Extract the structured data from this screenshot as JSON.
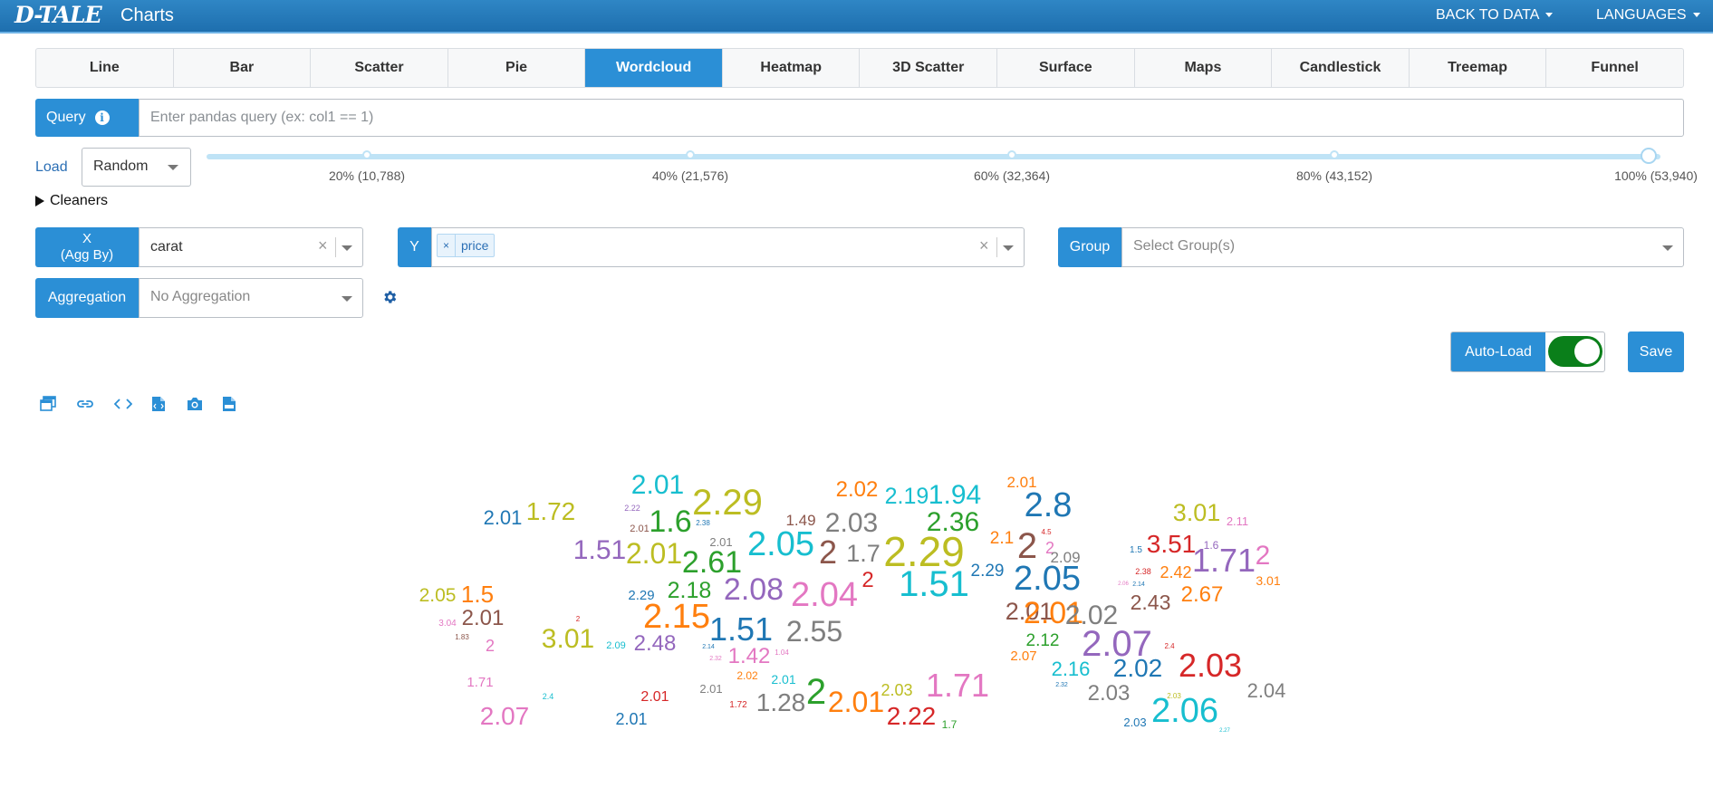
{
  "app": {
    "logo": "D-TALE",
    "title": "Charts"
  },
  "nav": {
    "back_to_data": "BACK TO DATA",
    "languages": "LANGUAGES"
  },
  "tabs": [
    {
      "label": "Line",
      "active": false
    },
    {
      "label": "Bar",
      "active": false
    },
    {
      "label": "Scatter",
      "active": false
    },
    {
      "label": "Pie",
      "active": false
    },
    {
      "label": "Wordcloud",
      "active": true
    },
    {
      "label": "Heatmap",
      "active": false
    },
    {
      "label": "3D Scatter",
      "active": false
    },
    {
      "label": "Surface",
      "active": false
    },
    {
      "label": "Maps",
      "active": false
    },
    {
      "label": "Candlestick",
      "active": false
    },
    {
      "label": "Treemap",
      "active": false
    },
    {
      "label": "Funnel",
      "active": false
    }
  ],
  "query": {
    "label": "Query",
    "value": "",
    "placeholder": "Enter pandas query (ex: col1 == 1)"
  },
  "load": {
    "label": "Load",
    "selected": "Random",
    "marks": [
      "20% (10,788)",
      "40% (21,576)",
      "60% (32,364)",
      "80% (43,152)",
      "100% (53,940)"
    ],
    "value_pct": 100
  },
  "cleaners": {
    "label": "Cleaners"
  },
  "x_axis": {
    "label_line1": "X",
    "label_line2": "(Agg By)",
    "value": "carat"
  },
  "y_axis": {
    "label": "Y",
    "tags": [
      "price"
    ]
  },
  "group": {
    "label": "Group",
    "placeholder": "Select Group(s)"
  },
  "aggregation": {
    "label": "Aggregation",
    "placeholder": "No Aggregation"
  },
  "controls": {
    "autoload_label": "Auto-Load",
    "autoload_on": true,
    "save_label": "Save"
  },
  "icons": [
    "popup-icon",
    "link-icon",
    "code-icon",
    "export-html-icon",
    "camera-icon",
    "export-csv-icon"
  ],
  "colors": {
    "accent": "#2b8fd6",
    "toggle_on": "#0a7f1a"
  },
  "chart_data": {
    "type": "wordcloud",
    "palette": [
      "#1f77b4",
      "#ff7f0e",
      "#2ca02c",
      "#d62728",
      "#9467bd",
      "#8c564b",
      "#e377c2",
      "#7f7f7f",
      "#bcbd22",
      "#17becf"
    ],
    "words": [
      {
        "text": "2.01",
        "size": 30,
        "color": 9
      },
      {
        "text": "1.72",
        "size": 28,
        "color": 8
      },
      {
        "text": "2.01",
        "size": 22,
        "color": 0
      },
      {
        "text": "2.29",
        "size": 40,
        "color": 8
      },
      {
        "text": "2.02",
        "size": 24,
        "color": 1
      },
      {
        "text": "2.19",
        "size": 25,
        "color": 9
      },
      {
        "text": "1.94",
        "size": 30,
        "color": 9
      },
      {
        "text": "2.01",
        "size": 17,
        "color": 1
      },
      {
        "text": "2.8",
        "size": 38,
        "color": 0
      },
      {
        "text": "3.01",
        "size": 27,
        "color": 8
      },
      {
        "text": "2.11",
        "size": 13,
        "color": 6
      },
      {
        "text": "2.22",
        "size": 9,
        "color": 4
      },
      {
        "text": "1.6",
        "size": 34,
        "color": 2
      },
      {
        "text": "2.01",
        "size": 11,
        "color": 5
      },
      {
        "text": "2.38",
        "size": 8,
        "color": 0
      },
      {
        "text": "1.49",
        "size": 17,
        "color": 5
      },
      {
        "text": "2.03",
        "size": 30,
        "color": 7
      },
      {
        "text": "2.36",
        "size": 30,
        "color": 2
      },
      {
        "text": "2",
        "size": 18,
        "color": 6
      },
      {
        "text": "1.51",
        "size": 30,
        "color": 4
      },
      {
        "text": "2.01",
        "size": 32,
        "color": 8
      },
      {
        "text": "2.01",
        "size": 13,
        "color": 7
      },
      {
        "text": "2.05",
        "size": 38,
        "color": 9
      },
      {
        "text": "2",
        "size": 36,
        "color": 5
      },
      {
        "text": "1.7",
        "size": 27,
        "color": 7
      },
      {
        "text": "2.29",
        "size": 46,
        "color": 8
      },
      {
        "text": "2.1",
        "size": 19,
        "color": 1
      },
      {
        "text": "4.5",
        "size": 8,
        "color": 3
      },
      {
        "text": "2",
        "size": 40,
        "color": 5
      },
      {
        "text": "2.09",
        "size": 17,
        "color": 7
      },
      {
        "text": "1.5",
        "size": 10,
        "color": 0
      },
      {
        "text": "3.51",
        "size": 28,
        "color": 3
      },
      {
        "text": "1.6",
        "size": 12,
        "color": 4
      },
      {
        "text": "1.71",
        "size": 36,
        "color": 4
      },
      {
        "text": "2",
        "size": 30,
        "color": 6
      },
      {
        "text": "2.61",
        "size": 34,
        "color": 2
      },
      {
        "text": "2.38",
        "size": 9,
        "color": 3
      },
      {
        "text": "2.42",
        "size": 18,
        "color": 1
      },
      {
        "text": "3.01",
        "size": 14,
        "color": 1
      },
      {
        "text": "2.05",
        "size": 21,
        "color": 8
      },
      {
        "text": "1.5",
        "size": 26,
        "color": 1
      },
      {
        "text": "2.29",
        "size": 15,
        "color": 0
      },
      {
        "text": "2.18",
        "size": 25,
        "color": 2
      },
      {
        "text": "2.08",
        "size": 34,
        "color": 4
      },
      {
        "text": "2.04",
        "size": 38,
        "color": 6
      },
      {
        "text": "2",
        "size": 24,
        "color": 3
      },
      {
        "text": "1.51",
        "size": 40,
        "color": 9
      },
      {
        "text": "2.29",
        "size": 19,
        "color": 0
      },
      {
        "text": "2.05",
        "size": 38,
        "color": 0
      },
      {
        "text": "2.06",
        "size": 6,
        "color": 6
      },
      {
        "text": "2.14",
        "size": 7,
        "color": 0
      },
      {
        "text": "2.43",
        "size": 23,
        "color": 5
      },
      {
        "text": "2.67",
        "size": 24,
        "color": 1
      },
      {
        "text": "2.01",
        "size": 27,
        "color": 5
      },
      {
        "text": "2.15",
        "size": 38,
        "color": 1
      },
      {
        "text": "2",
        "size": 8,
        "color": 3
      },
      {
        "text": "3.04",
        "size": 10,
        "color": 6
      },
      {
        "text": "1.83",
        "size": 8,
        "color": 5
      },
      {
        "text": "3.01",
        "size": 30,
        "color": 8
      },
      {
        "text": "2.09",
        "size": 11,
        "color": 9
      },
      {
        "text": "2.48",
        "size": 24,
        "color": 4
      },
      {
        "text": "2.14",
        "size": 7,
        "color": 0
      },
      {
        "text": "1.51",
        "size": 36,
        "color": 0
      },
      {
        "text": "2.55",
        "size": 32,
        "color": 7
      },
      {
        "text": "2.01",
        "size": 34,
        "color": 1
      },
      {
        "text": "2.02",
        "size": 30,
        "color": 7
      },
      {
        "text": "2.12",
        "size": 19,
        "color": 2
      },
      {
        "text": "2.07",
        "size": 40,
        "color": 4
      },
      {
        "text": "2.4",
        "size": 8,
        "color": 3
      },
      {
        "text": "2.07",
        "size": 15,
        "color": 1
      },
      {
        "text": "2.16",
        "size": 22,
        "color": 9
      },
      {
        "text": "2.02",
        "size": 28,
        "color": 0
      },
      {
        "text": "2.03",
        "size": 36,
        "color": 3
      },
      {
        "text": "1.42",
        "size": 24,
        "color": 6
      },
      {
        "text": "1.04",
        "size": 8,
        "color": 6
      },
      {
        "text": "2.32",
        "size": 7,
        "color": 6
      },
      {
        "text": "2.32",
        "size": 7,
        "color": 0
      },
      {
        "text": "2.02",
        "size": 12,
        "color": 1
      },
      {
        "text": "2.01",
        "size": 14,
        "color": 9
      },
      {
        "text": "1.71",
        "size": 15,
        "color": 6
      },
      {
        "text": "2.4",
        "size": 9,
        "color": 9
      },
      {
        "text": "2.01",
        "size": 16,
        "color": 3
      },
      {
        "text": "2.01",
        "size": 13,
        "color": 7
      },
      {
        "text": "1.72",
        "size": 10,
        "color": 3
      },
      {
        "text": "2",
        "size": 40,
        "color": 2
      },
      {
        "text": "1.28",
        "size": 28,
        "color": 7
      },
      {
        "text": "2.01",
        "size": 32,
        "color": 1
      },
      {
        "text": "2.03",
        "size": 18,
        "color": 8
      },
      {
        "text": "2.22",
        "size": 28,
        "color": 3
      },
      {
        "text": "1.71",
        "size": 36,
        "color": 6
      },
      {
        "text": "1.7",
        "size": 12,
        "color": 2
      },
      {
        "text": "2.03",
        "size": 24,
        "color": 7
      },
      {
        "text": "2.03",
        "size": 8,
        "color": 8
      },
      {
        "text": "2.04",
        "size": 22,
        "color": 7
      },
      {
        "text": "2.03",
        "size": 13,
        "color": 0
      },
      {
        "text": "2.06",
        "size": 38,
        "color": 9
      },
      {
        "text": "2.27",
        "size": 6,
        "color": 9
      },
      {
        "text": "2.07",
        "size": 28,
        "color": 6
      },
      {
        "text": "2.01",
        "size": 18,
        "color": 0
      },
      {
        "text": "2",
        "size": 18,
        "color": 6
      },
      {
        "text": "2.01",
        "size": 24,
        "color": 5
      }
    ]
  }
}
